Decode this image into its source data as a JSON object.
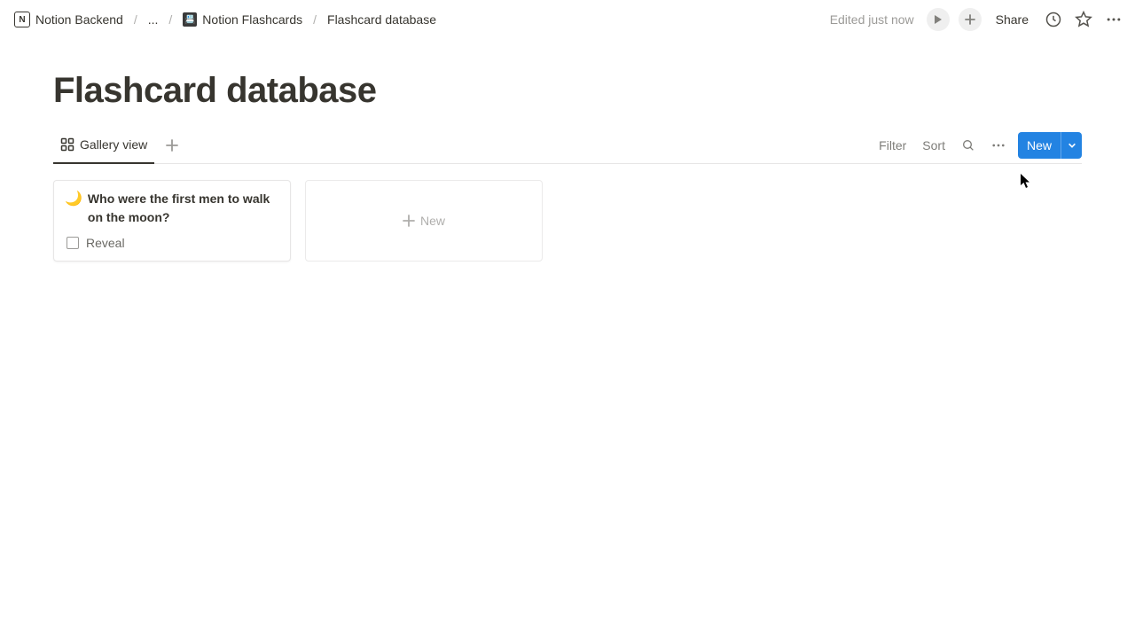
{
  "topbar": {
    "breadcrumb": {
      "root": "Notion Backend",
      "ellipsis": "...",
      "parent": "Notion Flashcards",
      "current": "Flashcard database"
    },
    "edited": "Edited just now",
    "share": "Share"
  },
  "page": {
    "title": "Flashcard database"
  },
  "view": {
    "active_tab": "Gallery view",
    "filter": "Filter",
    "sort": "Sort",
    "new_button": "New"
  },
  "cards": [
    {
      "emoji": "🌙",
      "title": "Who were the first men to walk on the moon?",
      "reveal_label": "Reveal",
      "reveal_checked": false
    }
  ],
  "new_card_label": "New"
}
